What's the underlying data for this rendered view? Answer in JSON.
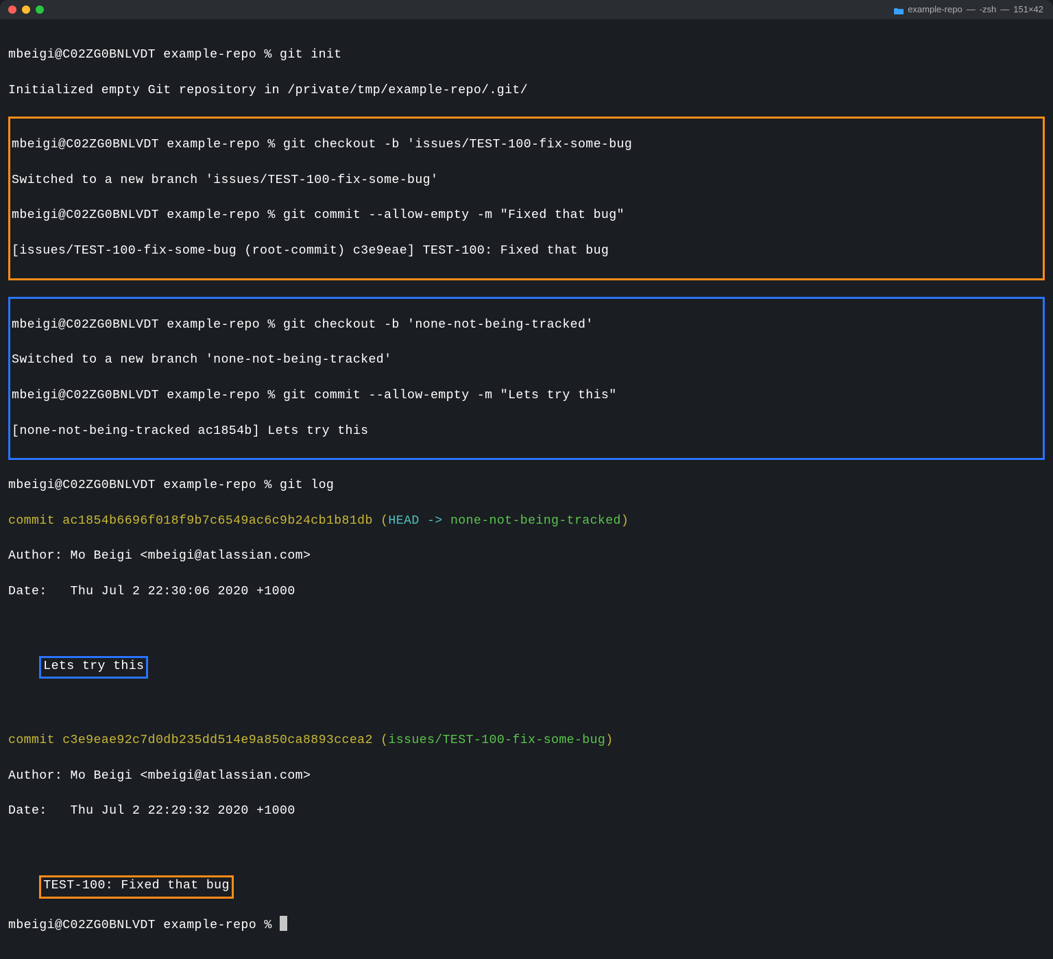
{
  "window": {
    "folder_name": "example-repo",
    "shell": "-zsh",
    "dimensions": "151×42"
  },
  "prompt": "mbeigi@C02ZG0BNLVDT example-repo % ",
  "lines": {
    "l1_cmd": "git init",
    "l1_out": "Initialized empty Git repository in /private/tmp/example-repo/.git/",
    "box1_l1_cmd": "git checkout -b 'issues/TEST-100-fix-some-bug",
    "box1_l1_out": "Switched to a new branch 'issues/TEST-100-fix-some-bug'",
    "box1_l2_cmd": "git commit --allow-empty -m \"Fixed that bug\"",
    "box1_l2_out": "[issues/TEST-100-fix-some-bug (root-commit) c3e9eae] TEST-100: Fixed that bug",
    "box2_l1_cmd": "git checkout -b 'none-not-being-tracked'",
    "box2_l1_out": "Switched to a new branch 'none-not-being-tracked'",
    "box2_l2_cmd": "git commit --allow-empty -m \"Lets try this\"",
    "box2_l2_out": "[none-not-being-tracked ac1854b] Lets try this",
    "gitlog_cmd": "git log",
    "commit1_hash": "commit ac1854b6696f018f9b7c6549ac6c9b24cb1b81db",
    "commit1_paren_open": " (",
    "commit1_head": "HEAD -> ",
    "commit1_branch": "none-not-being-tracked",
    "commit1_paren_close": ")",
    "commit1_author": "Author: Mo Beigi <mbeigi@atlassian.com>",
    "commit1_date": "Date:   Thu Jul 2 22:30:06 2020 +1000",
    "commit1_msg": "Lets try this",
    "commit2_hash": "commit c3e9eae92c7d0db235dd514e9a850ca8893ccea2",
    "commit2_paren_open": " (",
    "commit2_branch": "issues/TEST-100-fix-some-bug",
    "commit2_paren_close": ")",
    "commit2_author": "Author: Mo Beigi <mbeigi@atlassian.com>",
    "commit2_date": "Date:   Thu Jul 2 22:29:32 2020 +1000",
    "commit2_msg": "TEST-100: Fixed that bug"
  }
}
